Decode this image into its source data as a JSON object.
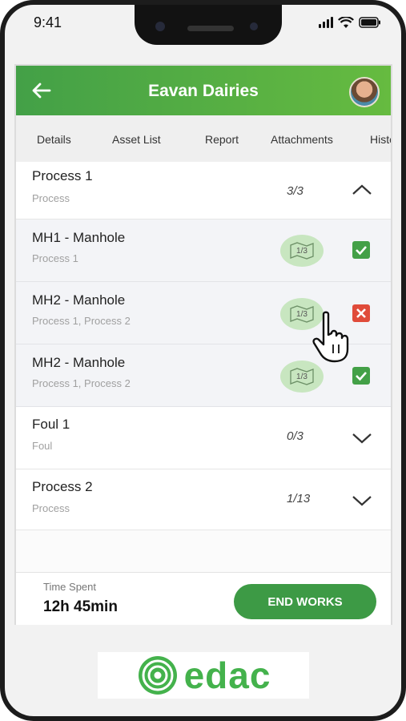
{
  "status_bar": {
    "time": "9:41"
  },
  "header": {
    "title": "Eavan Dairies"
  },
  "tabs": [
    "Details",
    "Asset List",
    "Report",
    "Attachments",
    "History"
  ],
  "rows": [
    {
      "kind": "group",
      "title": "Process 1",
      "subtitle": "Process",
      "count": "3/3",
      "expanded": true
    },
    {
      "kind": "asset",
      "title": "MH1 - Manhole",
      "subtitle": "Process 1",
      "map_label": "1/3",
      "status": "complete"
    },
    {
      "kind": "asset",
      "title": "MH2 - Manhole",
      "subtitle": "Process 1, Process 2",
      "map_label": "1/3",
      "status": "failed"
    },
    {
      "kind": "asset",
      "title": "MH2 - Manhole",
      "subtitle": "Process 1, Process 2",
      "map_label": "1/3",
      "status": "complete"
    },
    {
      "kind": "group",
      "title": "Foul 1",
      "subtitle": "Foul",
      "count": "0/3",
      "expanded": false
    },
    {
      "kind": "group",
      "title": "Process 2",
      "subtitle": "Process",
      "count": "1/13",
      "expanded": false
    }
  ],
  "footer": {
    "time_spent_label": "Time Spent",
    "time_spent_value": "12h 45min",
    "end_button": "END WORKS"
  },
  "brand": {
    "logo_text": "edac",
    "accent": "#43a047"
  },
  "icons": {
    "back": "arrow-left-icon",
    "collapse": "chevron-up-icon",
    "expand": "chevron-down-icon",
    "map": "map-icon",
    "complete": "check-icon",
    "failed": "close-icon",
    "pointer": "hand-pointer-icon"
  }
}
